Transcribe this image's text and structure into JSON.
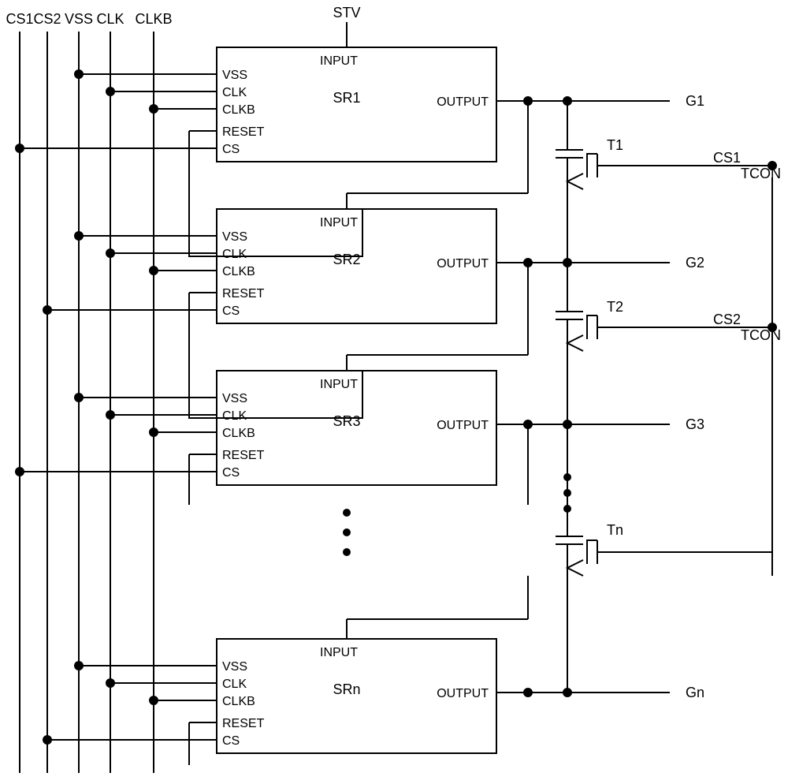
{
  "bus_labels": [
    "CS1",
    "CS2",
    "VSS",
    "CLK",
    "CLKB"
  ],
  "top_input": "STV",
  "blocks": [
    {
      "name": "SR1",
      "left_pins": [
        "VSS",
        "CLK",
        "CLKB",
        "RESET",
        "CS"
      ],
      "top_pin": "INPUT",
      "right_pin": "OUTPUT",
      "output_label": "G1",
      "transistor_label": "T1",
      "cs_bus": "CS1"
    },
    {
      "name": "SR2",
      "left_pins": [
        "VSS",
        "CLK",
        "CLKB",
        "RESET",
        "CS"
      ],
      "top_pin": "INPUT",
      "right_pin": "OUTPUT",
      "output_label": "G2",
      "transistor_label": "T2",
      "cs_bus": "CS2"
    },
    {
      "name": "SR3",
      "left_pins": [
        "VSS",
        "CLK",
        "CLKB",
        "RESET",
        "CS"
      ],
      "top_pin": "INPUT",
      "right_pin": "OUTPUT",
      "output_label": "G3",
      "transistor_label": "Tn",
      "cs_bus": "CS1"
    },
    {
      "name": "SRn",
      "left_pins": [
        "VSS",
        "CLK",
        "CLKB",
        "RESET",
        "CS"
      ],
      "top_pin": "INPUT",
      "right_pin": "OUTPUT",
      "output_label": "Gn",
      "transistor_label": "",
      "cs_bus": "CS2"
    }
  ],
  "tcon_signals": [
    {
      "label1": "CS1",
      "label2": "TCON"
    },
    {
      "label1": "CS2",
      "label2": "TCON"
    }
  ]
}
